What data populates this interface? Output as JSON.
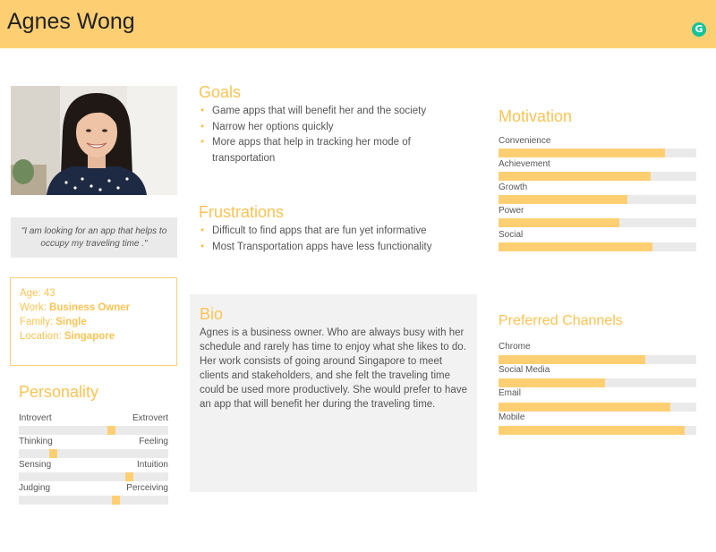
{
  "header": {
    "name": "Agnes Wong",
    "badge": "G"
  },
  "quote": "\"I am looking for an app that helps to occupy my traveling time .\"",
  "info": {
    "age_label": "Age:",
    "age_value": "43",
    "work_label": "Work:",
    "work_value": "Business Owner",
    "family_label": "Family:",
    "family_value": "Single",
    "location_label": "Location:",
    "location_value": "Singapore"
  },
  "personality": {
    "title": "Personality",
    "scales": [
      {
        "left": "Introvert",
        "right": "Extrovert",
        "value": 0.62
      },
      {
        "left": "Thinking",
        "right": "Feeling",
        "value": 0.23
      },
      {
        "left": "Sensing",
        "right": "Intuition",
        "value": 0.74
      },
      {
        "left": "Judging",
        "right": "Perceiving",
        "value": 0.65
      }
    ]
  },
  "goals": {
    "title": "Goals",
    "items": [
      "Game apps that will benefit her and the society",
      "Narrow her options quickly",
      "More apps that help in tracking her mode of transportation"
    ]
  },
  "frustrations": {
    "title": "Frustrations",
    "items": [
      "Difficult to find apps that are fun yet informative",
      "Most Transportation apps have less functionality"
    ]
  },
  "bio": {
    "title": "Bio",
    "text": "Agnes is a business owner. Who are always busy with her schedule and rarely has time to enjoy what she likes to do.\nHer work consists of going around Singapore to meet clients and stakeholders, and she felt the traveling time could be used more productively. She would prefer to have an app that will benefit her during the traveling time."
  },
  "motivation": {
    "title": "Motivation",
    "items": [
      {
        "label": "Convenience",
        "value": 0.84
      },
      {
        "label": "Achievement",
        "value": 0.77
      },
      {
        "label": "Growth",
        "value": 0.65
      },
      {
        "label": "Power",
        "value": 0.61
      },
      {
        "label": "Social",
        "value": 0.78
      }
    ]
  },
  "channels": {
    "title": "Preferred Channels",
    "items": [
      {
        "label": "Chrome",
        "value": 0.74
      },
      {
        "label": "Social Media",
        "value": 0.54
      },
      {
        "label": "Email",
        "value": 0.87
      },
      {
        "label": "Mobile",
        "value": 0.94
      }
    ]
  },
  "colors": {
    "accent": "#fecf72",
    "accent_text": "#fbc354",
    "track": "#eaeaea",
    "panel": "#f2f2f2"
  }
}
